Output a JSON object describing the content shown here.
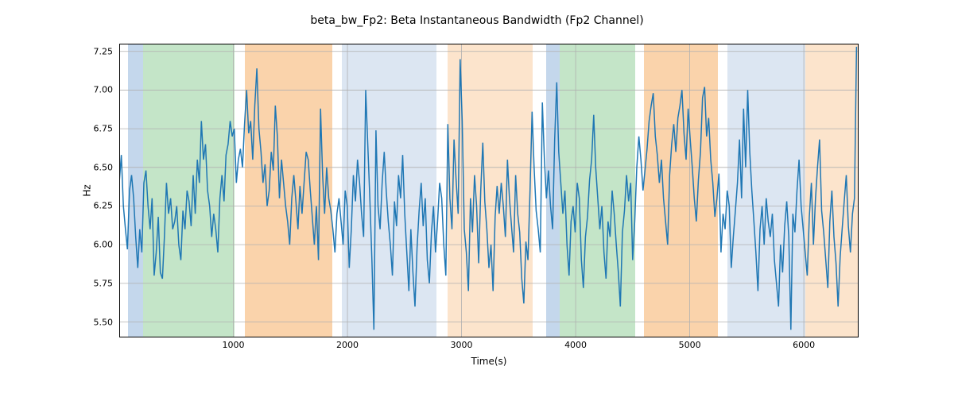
{
  "chart_data": {
    "type": "line",
    "title": "beta_bw_Fp2: Beta Instantaneous Bandwidth (Fp2 Channel)",
    "xlabel": "Time(s)",
    "ylabel": "Hz",
    "xlim": [
      0,
      6480
    ],
    "ylim": [
      5.4,
      7.3
    ],
    "xticks": [
      1000,
      2000,
      3000,
      4000,
      5000,
      6000
    ],
    "yticks": [
      5.5,
      5.75,
      6.0,
      6.25,
      6.5,
      6.75,
      7.0,
      7.25
    ],
    "grid": true,
    "bands": [
      {
        "start": 80,
        "end": 210,
        "color": "#c4d7ec"
      },
      {
        "start": 210,
        "end": 1010,
        "color": "#c4e5c8"
      },
      {
        "start": 1100,
        "end": 1870,
        "color": "#fad3ab"
      },
      {
        "start": 1950,
        "end": 2780,
        "color": "#dce6f2"
      },
      {
        "start": 2880,
        "end": 3620,
        "color": "#fce4cc"
      },
      {
        "start": 3740,
        "end": 3860,
        "color": "#c4d7ec"
      },
      {
        "start": 3860,
        "end": 4520,
        "color": "#c4e5c8"
      },
      {
        "start": 4600,
        "end": 5250,
        "color": "#fad3ab"
      },
      {
        "start": 5330,
        "end": 6010,
        "color": "#dce6f2"
      },
      {
        "start": 6010,
        "end": 6480,
        "color": "#fce4cc"
      }
    ],
    "series": [
      {
        "name": "beta_bw_Fp2",
        "color": "#1f77b4",
        "x_step": 18,
        "values": [
          6.4,
          6.58,
          6.25,
          6.1,
          5.97,
          6.35,
          6.45,
          6.3,
          6.05,
          5.85,
          6.1,
          5.95,
          6.4,
          6.48,
          6.25,
          6.1,
          6.3,
          5.8,
          5.95,
          6.18,
          5.82,
          5.78,
          6.05,
          6.4,
          6.2,
          6.3,
          6.1,
          6.15,
          6.25,
          6.0,
          5.9,
          6.22,
          6.1,
          6.35,
          6.28,
          6.12,
          6.45,
          6.2,
          6.55,
          6.4,
          6.8,
          6.55,
          6.65,
          6.35,
          6.25,
          6.05,
          6.2,
          6.1,
          5.95,
          6.3,
          6.45,
          6.28,
          6.58,
          6.65,
          6.8,
          6.7,
          6.75,
          6.4,
          6.55,
          6.62,
          6.5,
          6.78,
          7.0,
          6.72,
          6.8,
          6.55,
          6.9,
          7.14,
          6.75,
          6.6,
          6.4,
          6.52,
          6.25,
          6.35,
          6.6,
          6.48,
          6.9,
          6.7,
          6.3,
          6.55,
          6.4,
          6.25,
          6.15,
          6.0,
          6.3,
          6.45,
          6.28,
          6.1,
          6.38,
          6.2,
          6.4,
          6.6,
          6.55,
          6.35,
          6.18,
          6.0,
          6.25,
          5.9,
          6.88,
          6.45,
          6.2,
          6.5,
          6.3,
          6.22,
          6.1,
          5.95,
          6.2,
          6.3,
          6.15,
          6.0,
          6.35,
          6.25,
          5.85,
          6.1,
          6.45,
          6.28,
          6.55,
          6.4,
          6.2,
          6.05,
          7.0,
          6.65,
          6.3,
          5.9,
          5.45,
          6.74,
          6.25,
          6.1,
          6.4,
          6.6,
          6.35,
          6.15,
          6.0,
          5.8,
          6.28,
          6.12,
          6.45,
          6.3,
          6.58,
          6.2,
          5.95,
          5.7,
          6.1,
          5.82,
          5.6,
          5.98,
          6.22,
          6.4,
          6.12,
          6.3,
          5.9,
          5.75,
          6.08,
          6.25,
          5.95,
          6.15,
          6.4,
          6.3,
          6.0,
          5.8,
          6.78,
          6.3,
          6.1,
          6.68,
          6.42,
          6.2,
          7.2,
          6.8,
          6.1,
          5.95,
          5.7,
          6.3,
          6.08,
          6.45,
          6.25,
          5.88,
          6.35,
          6.66,
          6.28,
          6.1,
          5.85,
          6.0,
          5.7,
          6.18,
          6.38,
          6.2,
          6.4,
          6.25,
          6.05,
          6.55,
          6.3,
          6.12,
          5.95,
          6.45,
          6.2,
          6.08,
          5.78,
          5.62,
          6.02,
          5.9,
          6.35,
          6.86,
          6.5,
          6.22,
          6.1,
          5.95,
          6.92,
          6.55,
          6.3,
          6.48,
          6.25,
          6.1,
          6.68,
          7.05,
          6.6,
          6.4,
          6.2,
          6.35,
          6.0,
          5.8,
          6.15,
          6.25,
          6.08,
          6.4,
          6.3,
          5.9,
          5.72,
          6.05,
          6.18,
          6.42,
          6.55,
          6.84,
          6.5,
          6.3,
          6.1,
          6.25,
          5.95,
          5.78,
          6.15,
          6.05,
          6.35,
          6.2,
          6.0,
          5.82,
          5.6,
          6.08,
          6.22,
          6.45,
          6.28,
          6.4,
          5.9,
          6.15,
          6.5,
          6.7,
          6.55,
          6.35,
          6.48,
          6.62,
          6.8,
          6.9,
          6.98,
          6.7,
          6.58,
          6.4,
          6.55,
          6.3,
          6.15,
          6.0,
          6.45,
          6.65,
          6.78,
          6.6,
          6.82,
          6.9,
          7.0,
          6.72,
          6.55,
          6.88,
          6.68,
          6.5,
          6.3,
          6.15,
          6.42,
          6.6,
          6.95,
          7.02,
          6.7,
          6.82,
          6.55,
          6.4,
          6.18,
          6.3,
          6.46,
          5.95,
          6.2,
          6.1,
          6.35,
          6.25,
          5.85,
          6.05,
          6.22,
          6.4,
          6.68,
          6.3,
          6.88,
          6.5,
          7.0,
          6.6,
          6.35,
          6.15,
          5.95,
          5.7,
          6.1,
          6.25,
          6.0,
          6.3,
          6.15,
          6.05,
          6.2,
          5.9,
          5.75,
          5.6,
          6.0,
          5.82,
          6.12,
          6.28,
          6.05,
          5.45,
          6.2,
          6.08,
          6.35,
          6.55,
          6.25,
          6.1,
          5.95,
          5.8,
          6.18,
          6.4,
          6.0,
          6.3,
          6.5,
          6.68,
          6.22,
          6.08,
          5.9,
          5.72,
          6.15,
          6.35,
          6.05,
          5.88,
          5.6,
          5.92,
          6.1,
          6.28,
          6.45,
          6.12,
          5.95,
          6.2,
          6.3,
          7.28
        ]
      }
    ]
  }
}
